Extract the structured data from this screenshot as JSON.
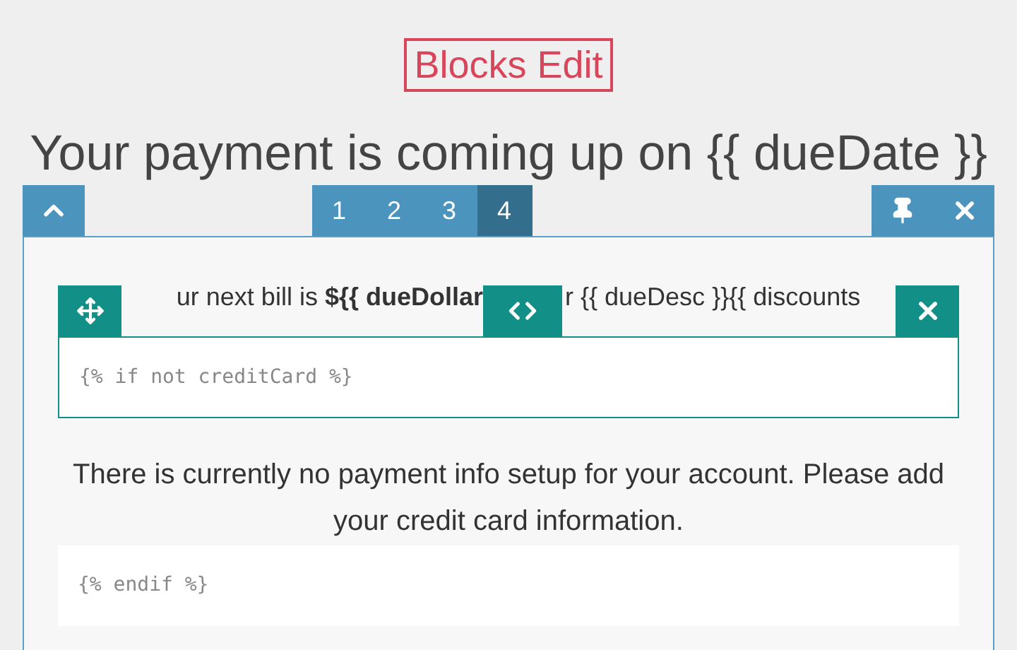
{
  "badge": {
    "title": "Blocks Edit"
  },
  "heading": "Your payment is coming up on {{ dueDate }}",
  "tabs": [
    {
      "label": "1",
      "selected": false
    },
    {
      "label": "2",
      "selected": false
    },
    {
      "label": "3",
      "selected": false
    },
    {
      "label": "4",
      "selected": true
    }
  ],
  "bill_line": {
    "before": "ur next bill is **${{ dueDollar**",
    "after": "r {{ dueDesc }}{{ discounts"
  },
  "condition_field": {
    "value": "{% if not creditCard %}"
  },
  "message": "There is currently no payment info setup for your account. Please add your credit card information.",
  "end_block": {
    "value": "{% endif %}"
  }
}
